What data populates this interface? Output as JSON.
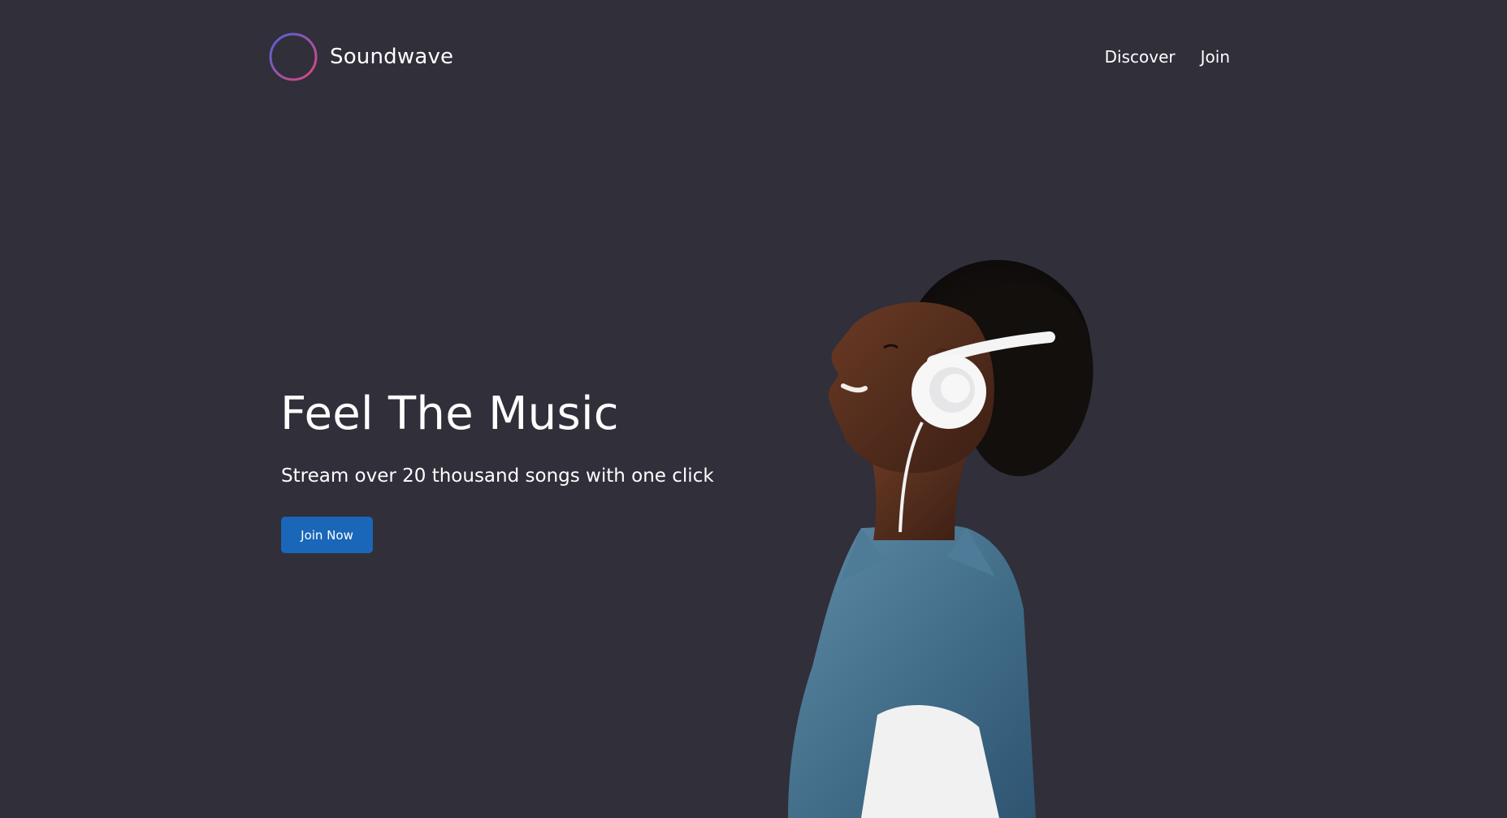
{
  "brand": {
    "name": "Soundwave",
    "icon": "soundwave-logo-icon",
    "gradient_start": "#5b5fd6",
    "gradient_end": "#e0457b"
  },
  "nav": {
    "items": [
      {
        "label": "Discover"
      },
      {
        "label": "Join"
      }
    ]
  },
  "hero": {
    "title": "Feel The Music",
    "subtitle": "Stream over 20 thousand songs with one click",
    "cta_label": "Join Now",
    "image": "man-with-headphones-photo"
  },
  "colors": {
    "background": "#302f3a",
    "accent": "#1a66b8",
    "text": "#ffffff"
  }
}
